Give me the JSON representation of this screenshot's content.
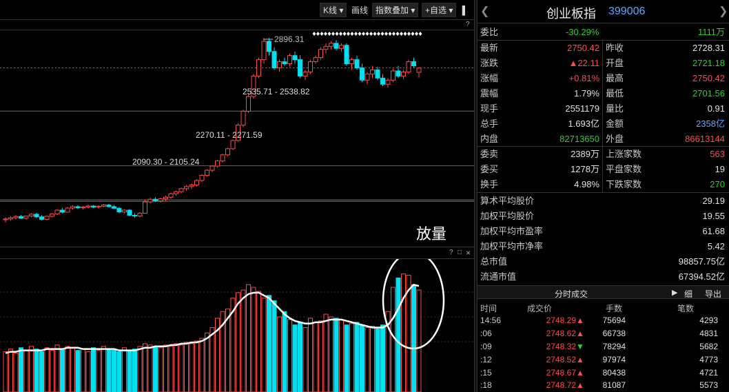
{
  "toolbar": {
    "kline": "K线",
    "draw": "画线",
    "overlay": "指数叠加",
    "watchlist": "+自选",
    "collapse_icon": "▌",
    "close": "×"
  },
  "main_chart": {
    "high_label": "2896.31",
    "zones": [
      "2535.71 - 2538.82",
      "2270.11 - 2271.59",
      "2090.30 - 2105.24"
    ],
    "help": "?"
  },
  "annotation": {
    "text": "放量"
  },
  "volume_head": {
    "help": "?",
    "extra": "□",
    "close": "×"
  },
  "chart_data": {
    "type": "candlestick",
    "ohlc": [
      [
        2008,
        2020,
        1995,
        2012
      ],
      [
        2012,
        2025,
        2003,
        2018
      ],
      [
        2018,
        2030,
        2010,
        2024
      ],
      [
        2024,
        2032,
        2012,
        2015
      ],
      [
        2015,
        2028,
        2008,
        2026
      ],
      [
        2026,
        2040,
        2020,
        2035
      ],
      [
        2035,
        2042,
        2018,
        2022
      ],
      [
        2022,
        2030,
        2005,
        2010
      ],
      [
        2010,
        2028,
        2005,
        2025
      ],
      [
        2025,
        2040,
        2020,
        2036
      ],
      [
        2036,
        2060,
        2030,
        2055
      ],
      [
        2055,
        2066,
        2040,
        2045
      ],
      [
        2045,
        2070,
        2043,
        2065
      ],
      [
        2065,
        2078,
        2058,
        2072
      ],
      [
        2072,
        2080,
        2060,
        2066
      ],
      [
        2066,
        2075,
        2058,
        2070
      ],
      [
        2070,
        2082,
        2062,
        2075
      ],
      [
        2075,
        2080,
        2065,
        2070
      ],
      [
        2070,
        2078,
        2062,
        2074
      ],
      [
        2074,
        2085,
        2068,
        2080
      ],
      [
        2080,
        2086,
        2068,
        2072
      ],
      [
        2072,
        2080,
        2060,
        2064
      ],
      [
        2064,
        2070,
        2040,
        2046
      ],
      [
        2046,
        2060,
        2040,
        2055
      ],
      [
        2055,
        2060,
        2025,
        2030
      ],
      [
        2030,
        2040,
        2018,
        2026
      ],
      [
        2026,
        2045,
        2020,
        2040
      ],
      [
        2040,
        2105,
        2038,
        2095
      ],
      [
        2095,
        2115,
        2088,
        2108
      ],
      [
        2108,
        2118,
        2095,
        2100
      ],
      [
        2100,
        2115,
        2092,
        2110
      ],
      [
        2110,
        2125,
        2100,
        2118
      ],
      [
        2118,
        2140,
        2110,
        2135
      ],
      [
        2135,
        2150,
        2125,
        2145
      ],
      [
        2145,
        2165,
        2138,
        2160
      ],
      [
        2160,
        2175,
        2150,
        2170
      ],
      [
        2170,
        2185,
        2158,
        2178
      ],
      [
        2178,
        2205,
        2170,
        2200
      ],
      [
        2200,
        2230,
        2192,
        2225
      ],
      [
        2225,
        2255,
        2218,
        2250
      ],
      [
        2250,
        2275,
        2240,
        2270
      ],
      [
        2270,
        2300,
        2262,
        2295
      ],
      [
        2295,
        2330,
        2288,
        2325
      ],
      [
        2325,
        2360,
        2318,
        2355
      ],
      [
        2355,
        2400,
        2348,
        2395
      ],
      [
        2395,
        2480,
        2390,
        2470
      ],
      [
        2470,
        2545,
        2460,
        2538
      ],
      [
        2538,
        2620,
        2530,
        2610
      ],
      [
        2610,
        2720,
        2600,
        2710
      ],
      [
        2710,
        2800,
        2700,
        2790
      ],
      [
        2790,
        2896,
        2770,
        2880
      ],
      [
        2880,
        2896,
        2810,
        2830
      ],
      [
        2830,
        2850,
        2740,
        2750
      ],
      [
        2750,
        2790,
        2730,
        2780
      ],
      [
        2780,
        2800,
        2760,
        2770
      ],
      [
        2770,
        2820,
        2755,
        2810
      ],
      [
        2810,
        2830,
        2770,
        2790
      ],
      [
        2790,
        2812,
        2700,
        2710
      ],
      [
        2710,
        2740,
        2690,
        2730
      ],
      [
        2730,
        2790,
        2720,
        2780
      ],
      [
        2780,
        2810,
        2770,
        2800
      ],
      [
        2800,
        2850,
        2790,
        2840
      ],
      [
        2840,
        2870,
        2820,
        2855
      ],
      [
        2855,
        2880,
        2840,
        2870
      ],
      [
        2870,
        2885,
        2835,
        2845
      ],
      [
        2845,
        2870,
        2830,
        2860
      ],
      [
        2860,
        2870,
        2760,
        2770
      ],
      [
        2770,
        2800,
        2740,
        2790
      ],
      [
        2790,
        2810,
        2740,
        2750
      ],
      [
        2750,
        2770,
        2680,
        2690
      ],
      [
        2690,
        2730,
        2670,
        2720
      ],
      [
        2720,
        2760,
        2700,
        2740
      ],
      [
        2740,
        2755,
        2690,
        2700
      ],
      [
        2700,
        2720,
        2660,
        2670
      ],
      [
        2670,
        2700,
        2655,
        2690
      ],
      [
        2690,
        2745,
        2680,
        2735
      ],
      [
        2735,
        2760,
        2700,
        2710
      ],
      [
        2710,
        2740,
        2695,
        2730
      ],
      [
        2730,
        2790,
        2720,
        2780
      ],
      [
        2780,
        2800,
        2750,
        2760
      ],
      [
        2728,
        2750,
        2702,
        2750
      ]
    ],
    "volume": [
      30,
      32,
      29,
      33,
      31,
      34,
      32,
      30,
      33,
      31,
      35,
      32,
      34,
      33,
      31,
      32,
      30,
      33,
      31,
      34,
      32,
      31,
      30,
      33,
      31,
      32,
      34,
      36,
      35,
      34,
      33,
      35,
      34,
      36,
      35,
      37,
      36,
      38,
      40,
      44,
      48,
      55,
      60,
      62,
      70,
      74,
      76,
      80,
      78,
      75,
      70,
      72,
      68,
      56,
      60,
      54,
      50,
      52,
      48,
      55,
      52,
      53,
      58,
      56,
      55,
      54,
      50,
      51,
      52,
      50,
      48,
      49,
      47,
      50,
      60,
      78,
      85,
      88,
      87,
      80,
      76
    ],
    "volume_ma": [
      29,
      30,
      30,
      31,
      31,
      31,
      31,
      31,
      32,
      32,
      32,
      32,
      33,
      33,
      33,
      32,
      32,
      32,
      32,
      32,
      32,
      32,
      31,
      31,
      31,
      31,
      32,
      33,
      33,
      34,
      34,
      34,
      35,
      35,
      36,
      36,
      37,
      37,
      38,
      40,
      43,
      46,
      50,
      55,
      60,
      66,
      70,
      73,
      74,
      74,
      72,
      70,
      66,
      62,
      58,
      55,
      53,
      52,
      51,
      51,
      52,
      52,
      53,
      54,
      54,
      54,
      53,
      52,
      51,
      50,
      49,
      48,
      48,
      48,
      50,
      55,
      62,
      70,
      76,
      80,
      79
    ]
  },
  "quote": {
    "name": "创业板指",
    "code": "399006",
    "weibi_label": "委比",
    "weibi": "-30.29%",
    "weicha": "1111万",
    "latest_label": "最新",
    "latest": "2750.42",
    "prevclose_label": "昨收",
    "prevclose": "2728.31",
    "change_label": "涨跌",
    "change": "▲22.11",
    "open_label": "开盘",
    "open": "2721.18",
    "pct_label": "涨幅",
    "pct": "+0.81%",
    "high_label": "最高",
    "high": "2750.42",
    "amp_label": "震幅",
    "amp": "1.79%",
    "low_label": "最低",
    "low": "2701.56",
    "curhand_label": "现手",
    "curhand": "2551179",
    "volratio_label": "量比",
    "volratio": "0.91",
    "totalhand_label": "总手",
    "totalhand": "1.693亿",
    "amount_label": "金额",
    "amount": "2358亿",
    "inner_label": "内盘",
    "inner": "82713650",
    "outer_label": "外盘",
    "outer": "86613144",
    "sell_label": "委卖",
    "sell": "2389万",
    "upcount_label": "上涨家数",
    "upcount": "563",
    "buy_label": "委买",
    "buy": "1278万",
    "flatcount_label": "平盘家数",
    "flatcount": "19",
    "turnover_label": "换手",
    "turnover": "4.98%",
    "downcount_label": "下跌家数",
    "downcount": "270"
  },
  "stats": [
    {
      "label": "算术平均股价",
      "value": "29.19"
    },
    {
      "label": "加权平均股价",
      "value": "19.55"
    },
    {
      "label": "加权平均市盈率",
      "value": "61.68"
    },
    {
      "label": "加权平均市净率",
      "value": "5.42"
    },
    {
      "label": "总市值",
      "value": "98857.75亿"
    },
    {
      "label": "流通市值",
      "value": "67394.52亿"
    }
  ],
  "ticks": {
    "title": "分时成交",
    "btn_play": "▶",
    "btn_detail": "细",
    "btn_export": "导出",
    "col_time": "时间",
    "col_price": "成交价",
    "col_hands": "手数",
    "col_count": "笔数",
    "rows": [
      {
        "time": "14:56",
        "price": "2748.29",
        "dir": "▲",
        "hands": "75694",
        "count": "4293"
      },
      {
        "time": ":06",
        "price": "2748.62",
        "dir": "▲",
        "hands": "66738",
        "count": "4831"
      },
      {
        "time": ":09",
        "price": "2748.32",
        "dir": "▼",
        "hands": "78294",
        "count": "5682"
      },
      {
        "time": ":12",
        "price": "2748.52",
        "dir": "▲",
        "hands": "97974",
        "count": "4773"
      },
      {
        "time": ":15",
        "price": "2748.67",
        "dir": "▲",
        "hands": "80438",
        "count": "4721"
      },
      {
        "time": ":18",
        "price": "2748.72",
        "dir": "▲",
        "hands": "81087",
        "count": "5573"
      }
    ]
  },
  "colors": {
    "up": "#ff4c4c",
    "down": "#00e0f0",
    "ma": "#ffffff",
    "code": "#5aa8ff"
  }
}
